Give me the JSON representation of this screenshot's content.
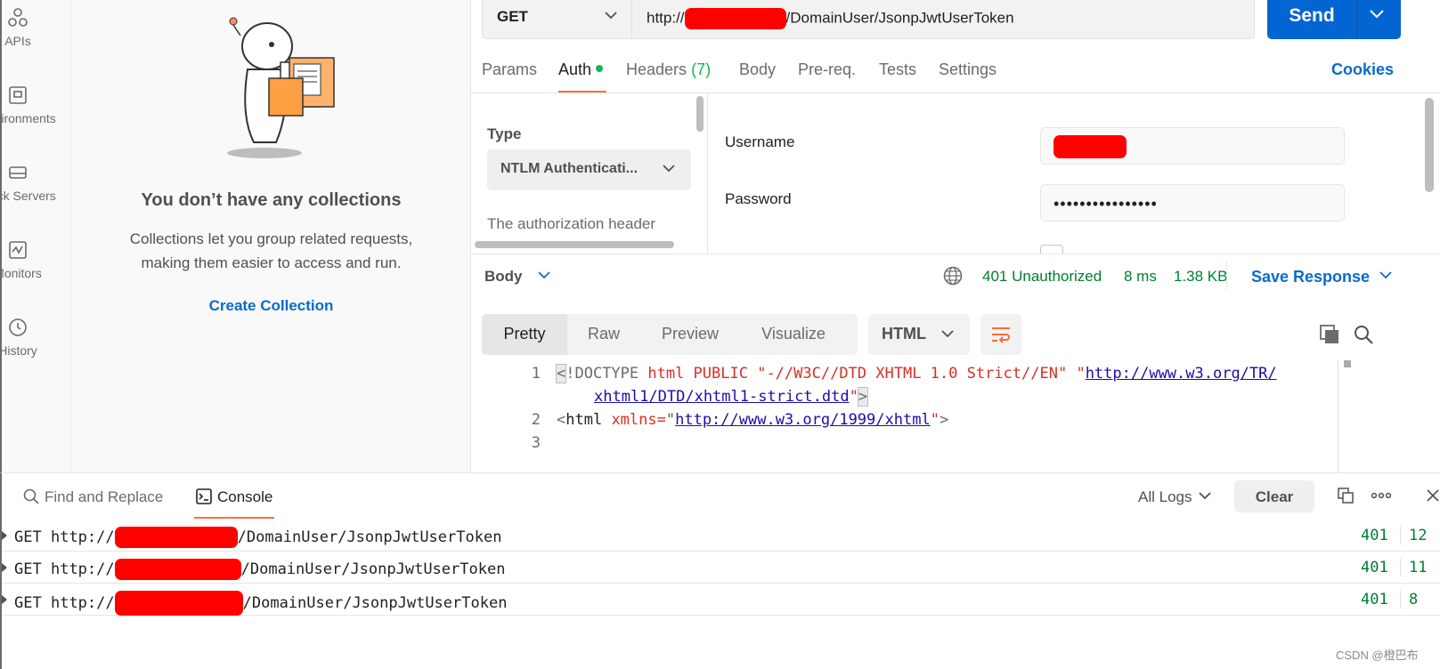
{
  "nav": {
    "items": [
      {
        "label": "APIs",
        "icon": "apis-icon"
      },
      {
        "label": "Environments",
        "icon": "environments-icon"
      },
      {
        "label": "Mock Servers",
        "icon": "mock-servers-icon"
      },
      {
        "label": "Monitors",
        "icon": "monitors-icon"
      },
      {
        "label": "History",
        "icon": "history-icon"
      }
    ]
  },
  "collections": {
    "empty_title": "You don’t have any collections",
    "empty_desc": "Collections let you group related requests, making them easier to access and run.",
    "create_label": "Create Collection"
  },
  "request": {
    "method": "GET",
    "url_prefix": "http://",
    "url_suffix": "/DomainUser/JsonpJwtUserToken",
    "send_label": "Send",
    "tabs": {
      "params": "Params",
      "auth": "Auth",
      "headers": "Headers",
      "headers_count": "(7)",
      "body": "Body",
      "prereq": "Pre-req.",
      "tests": "Tests",
      "settings": "Settings"
    },
    "cookies_label": "Cookies"
  },
  "auth": {
    "type_label": "Type",
    "type_value": "NTLM Authenticati...",
    "help_text": "The authorization header",
    "username_label": "Username",
    "password_label": "Password",
    "password_value": "••••••••••••••••"
  },
  "response": {
    "body_label": "Body",
    "status": "401 Unauthorized",
    "time": "8 ms",
    "size": "1.38 KB",
    "save_label": "Save Response",
    "view_tabs": {
      "pretty": "Pretty",
      "raw": "Raw",
      "preview": "Preview",
      "visualize": "Visualize"
    },
    "format": "HTML",
    "code": {
      "l1_tag": "!DOCTYPE",
      "l1_kw": " html PUBLIC ",
      "l1_str": "\"-//W3C//DTD XHTML 1.0 Strict//EN\" ",
      "l1_link": "http://www.w3.org/TR/",
      "l1b_link": "xhtml1/DTD/xhtml1-strict.dtd",
      "l2_tag": "html",
      "l2_attr": " xmlns=",
      "l2_link": "http://www.w3.org/1999/xhtml",
      "line_numbers": [
        "1",
        "2",
        "3"
      ]
    }
  },
  "console": {
    "find_replace_label": "Find and Replace",
    "console_label": "Console",
    "all_logs_label": "All Logs",
    "clear_label": "Clear",
    "logs": [
      {
        "method": "GET",
        "prefix": "http://",
        "path": "/DomainUser/JsonpJwtUserToken",
        "status": "401",
        "ms": "12"
      },
      {
        "method": "GET",
        "prefix": "http://",
        "path": "/DomainUser/JsonpJwtUserToken",
        "status": "401",
        "ms": "11"
      },
      {
        "method": "GET",
        "prefix": "http://",
        "path": "/DomainUser/JsonpJwtUserToken",
        "status": "401",
        "ms": "8"
      }
    ]
  },
  "watermark": "CSDN @橙巴布",
  "colors": {
    "accent": "#ff6c37",
    "primary": "#0265d2",
    "link": "#0b6bcb",
    "success": "#007f31",
    "redaction": "#ff0000"
  }
}
